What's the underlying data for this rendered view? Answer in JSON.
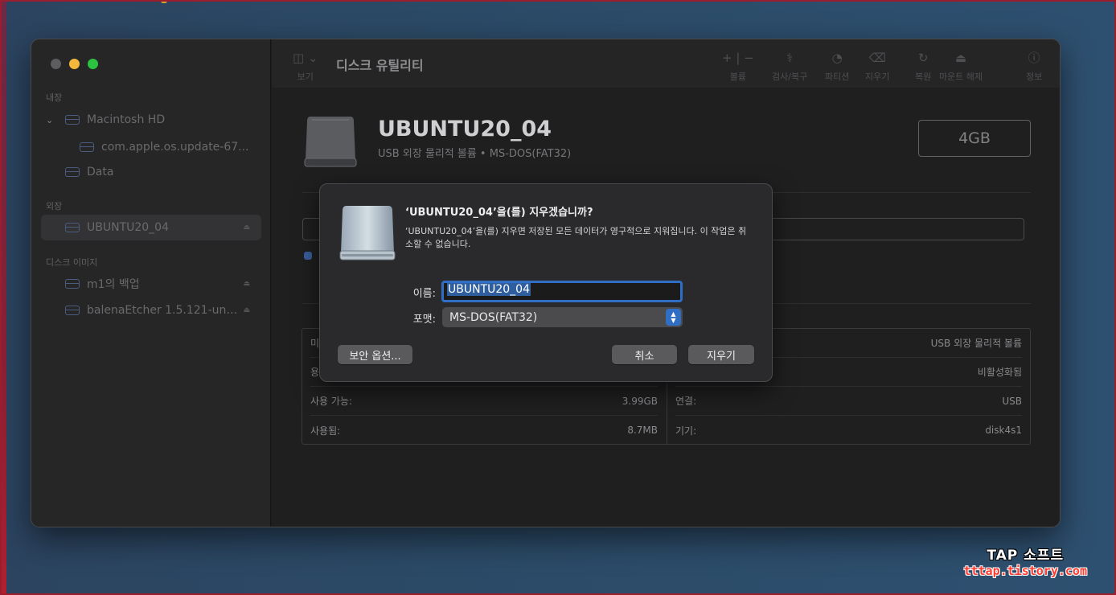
{
  "app": {
    "title": "디스크 유틸리티"
  },
  "sidebar": {
    "sections": [
      {
        "label": "내장"
      },
      {
        "label": "외장"
      },
      {
        "label": "디스크 이미지"
      }
    ],
    "items": [
      {
        "label": "Macintosh HD"
      },
      {
        "label": "com.apple.os.update-67..."
      },
      {
        "label": "Data"
      },
      {
        "label": "UBUNTU20_04"
      },
      {
        "label": "m1의 백업"
      },
      {
        "label": "balenaEtcher 1.5.121-uni..."
      }
    ]
  },
  "toolbar": {
    "view_label": "보기",
    "volume_label": "볼륨",
    "firstaid_label": "검사/복구",
    "partition_label": "파티션",
    "erase_label": "지우기",
    "restore_label": "복원",
    "unmount_label": "마운트 해제",
    "info_label": "정보"
  },
  "volume": {
    "name": "UBUNTU20_04",
    "subtitle": "USB 외장 물리적 볼륨 • MS-DOS(FAT32)",
    "capacity": "4GB"
  },
  "info": {
    "left": [
      {
        "label": "미",
        "value": ""
      },
      {
        "label": "용",
        "value": ""
      },
      {
        "label": "사용 가능:",
        "value": "3.99GB"
      },
      {
        "label": "사용됨:",
        "value": "8.7MB"
      }
    ],
    "right": [
      {
        "label": "",
        "value": "USB 외장 물리적 볼륨"
      },
      {
        "label": "",
        "value": "비활성화됨"
      },
      {
        "label": "연결:",
        "value": "USB"
      },
      {
        "label": "기기:",
        "value": "disk4s1"
      }
    ]
  },
  "dialog": {
    "title": "‘UBUNTU20_04’을(를) 지우겠습니까?",
    "message": "‘UBUNTU20_04’을(를) 지우면 저장된 모든 데이터가 영구적으로 지워집니다. 이 작업은 취소할 수 없습니다.",
    "name_label": "이름:",
    "name_value": "UBUNTU20_04",
    "format_label": "포맷:",
    "format_value": "MS-DOS(FAT32)",
    "security_button": "보안 옵션...",
    "cancel_button": "취소",
    "erase_button": "지우기"
  },
  "watermark": {
    "title": "TAP 소프트",
    "url": "tttap.tistory.com"
  },
  "colors": {
    "accent": "#2f6ec4",
    "close": "#5d5d60",
    "minimize": "#f4b83a",
    "maximize": "#2cc340"
  }
}
